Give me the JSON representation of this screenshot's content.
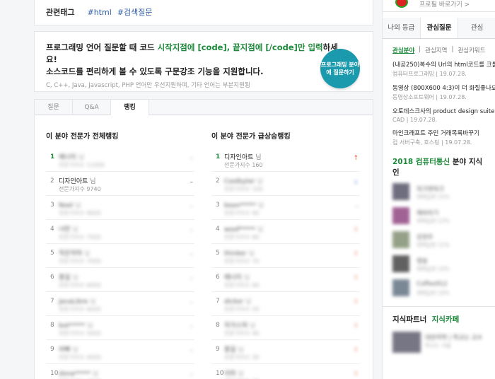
{
  "tags": {
    "label": "관련태그",
    "items": [
      "#html",
      "#검색질문"
    ]
  },
  "promo": {
    "line1_a": "프로그래밍 언어 질문할 때 코드 ",
    "line1_b": "시작지점에 [code], 끝지점에 [/code]만 입력",
    "line1_c": "하세",
    "line2": "요!",
    "line3": "소스코드를 편리하게 볼 수 있도록 구문강조 기능을 지원합니다.",
    "line4": "C, C++, Java, Javascript, PHP 언어만 우선지원하며, 기타 언어는 부분지원됨",
    "button": "프로그래밍 분야에 질문하기"
  },
  "tabs": [
    {
      "label": "질문",
      "active": false
    },
    {
      "label": "Q&A",
      "active": false
    },
    {
      "label": "랭킹",
      "active": true
    }
  ],
  "ranking_total": {
    "title": "이 분야 전문가 전체랭킹",
    "rows": [
      {
        "rank": "1",
        "name": "에너지",
        "suffix": " 님",
        "sub": "전문가지수 11000",
        "change": "–",
        "blur": true,
        "top": true
      },
      {
        "rank": "2",
        "name": "디자인아트",
        "suffix": " 님",
        "sub": "전문가지수 9740",
        "change": "–",
        "blur": false,
        "top": false
      },
      {
        "rank": "3",
        "name": "Noel",
        "suffix": " 님",
        "sub": "전문가지수 9000",
        "change": "–",
        "blur": true,
        "top": false
      },
      {
        "rank": "4",
        "name": "너만",
        "suffix": " 님",
        "sub": "전문가지수 7000",
        "change": "–",
        "blur": true,
        "top": false
      },
      {
        "rank": "5",
        "name": "작은악마",
        "suffix": " 님",
        "sub": "전문가지수 7000",
        "change": "–",
        "blur": true,
        "top": false
      },
      {
        "rank": "6",
        "name": "홍길",
        "suffix": " 님",
        "sub": "전문가지수 6000",
        "change": "–",
        "blur": true,
        "top": false
      },
      {
        "rank": "7",
        "name": "JavaLibre",
        "suffix": " 님",
        "sub": "전문가지수 6000",
        "change": "–",
        "blur": true,
        "top": false
      },
      {
        "rank": "8",
        "name": "bot*****",
        "suffix": " 님",
        "sub": "전문가지수 5000",
        "change": "–",
        "blur": true,
        "top": false
      },
      {
        "rank": "9",
        "name": "아빠",
        "suffix": " 님",
        "sub": "전문가지수 4000",
        "change": "–",
        "blur": true,
        "top": false
      },
      {
        "rank": "10",
        "name": "dona*****",
        "suffix": " 님",
        "sub": "전문가지수 4000",
        "change": "–",
        "blur": true,
        "top": false
      }
    ]
  },
  "ranking_rising": {
    "title": "이 분야 전문가 급상승랭킹",
    "rows": [
      {
        "rank": "1",
        "name": "디자인아트",
        "suffix": " 님",
        "sub": "전문가지수 160",
        "change": "↑",
        "blur": false,
        "top": true
      },
      {
        "rank": "2",
        "name": "Coolbyter",
        "suffix": " 님",
        "sub": "전문가지수 100",
        "change": "↓",
        "blur": true,
        "top": false
      },
      {
        "rank": "3",
        "name": "boon*****",
        "suffix": " 님",
        "sub": "전문가지수 90",
        "change": "–",
        "blur": true,
        "top": false
      },
      {
        "rank": "4",
        "name": "woof*****",
        "suffix": " 님",
        "sub": "전문가지수 80",
        "change": "↑",
        "blur": true,
        "top": false
      },
      {
        "rank": "5",
        "name": "thinker",
        "suffix": " 님",
        "sub": "전문가지수 70",
        "change": "↑",
        "blur": true,
        "top": false
      },
      {
        "rank": "6",
        "name": "에너지",
        "suffix": " 님",
        "sub": "전문가지수 60",
        "change": "↑",
        "blur": true,
        "top": false
      },
      {
        "rank": "7",
        "name": "dickor",
        "suffix": " 님",
        "sub": "전문가지수 50",
        "change": "↑",
        "blur": true,
        "top": false
      },
      {
        "rank": "8",
        "name": "자가스마",
        "suffix": " 님",
        "sub": "전문가지수 40",
        "change": "↑",
        "blur": true,
        "top": false
      },
      {
        "rank": "9",
        "name": "홍길",
        "suffix": " 님",
        "sub": "전문가지수 30",
        "change": "↑",
        "blur": true,
        "top": false
      },
      {
        "rank": "10",
        "name": "이마",
        "suffix": " 님",
        "sub": "전문가지수 20",
        "change": "↑",
        "blur": true,
        "top": false
      }
    ]
  },
  "profile": {
    "text": "프로필 바로가기 >"
  },
  "right_tabs": [
    {
      "label": "나의 등급",
      "active": false
    },
    {
      "label": "관심질문",
      "active": true
    },
    {
      "label": "관심",
      "active": false
    }
  ],
  "subfilter": [
    "관심분야",
    "관심지역",
    "관심키워드"
  ],
  "questions": [
    {
      "title": "(내공250)복수의 Url의 html코드를 크롤",
      "cat": "컴퓨터프로그래밍",
      "date": "19.07.28."
    },
    {
      "title": "동영상 (800X600 4:3)이 더 화질좋나요",
      "cat": "동영상소프트웨어",
      "date": "19.07.28."
    },
    {
      "title": "오토데스크사의 product design suite ul",
      "cat": "CAD",
      "date": "19.07.28."
    },
    {
      "title": "마인크래프트 주민 거래목록바꾸기",
      "cat": "컴 서버구축, 호스팅",
      "date": "19.07.28."
    }
  ],
  "knowledge_section": {
    "year": "2018 컴퓨터통신",
    "rest": " 분야 지식인"
  },
  "people": [
    {
      "name": "워크앤워크",
      "sub": "채택답변 15%",
      "color": "#4a4a5e"
    },
    {
      "name": "해바라기",
      "sub": "채택답변 12%",
      "color": "#8a3a7a"
    },
    {
      "name": "강현우",
      "sub": "채택답변 11%",
      "color": "#7a8a6a"
    },
    {
      "name": "맹용",
      "sub": "채택답변 10%",
      "color": "#3a3a3a"
    },
    {
      "name": "Coffee912",
      "sub": "채택답변 10%",
      "color": "#5a6a7a"
    }
  ],
  "partner_section": {
    "a": "지식파트너",
    "b": "지식카페"
  },
  "partner": {
    "name": "대한약학 | 학교는 교수",
    "sub": "학교는 서울"
  }
}
